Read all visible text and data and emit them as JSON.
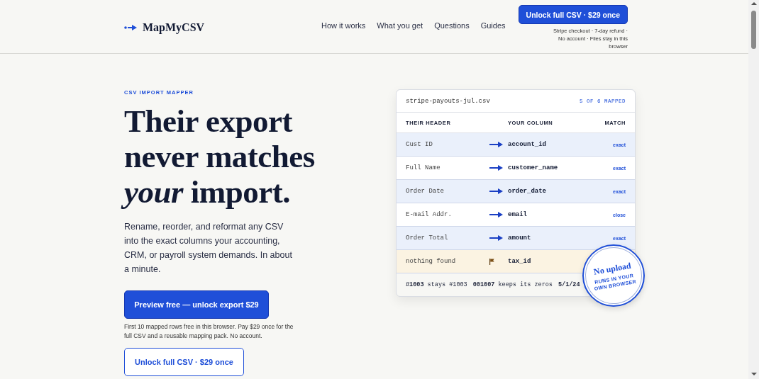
{
  "header": {
    "logo": "MapMyCSV",
    "nav": [
      "How it works",
      "What you get",
      "Questions",
      "Guides"
    ],
    "cta": "Unlock full CSV · $29 once",
    "cta_note": "Stripe checkout · 7-day refund · No account · Files stay in this browser"
  },
  "hero": {
    "eyebrow": "CSV IMPORT MAPPER",
    "heading_lines": [
      "Their export",
      "never matches",
      "*your* import."
    ],
    "lead": "Rename, reorder, and reformat any CSV into the exact columns your accounting, CRM, or payroll system demands. In about a minute.",
    "primary_button": "Preview free — unlock export $29",
    "primary_note": "First 10 mapped rows free in this browser. Pay $29 once for the full CSV and a reusable mapping pack. No account.",
    "secondary_button": "Unlock full CSV · $29 once"
  },
  "mapper": {
    "file_name": "stripe-payouts-jul.csv",
    "status": "5 OF 6 MAPPED",
    "columns": [
      "THEIR HEADER",
      "YOUR COLUMN",
      "MATCH"
    ],
    "rows": [
      {
        "kind": "mapped",
        "their": "Cust ID",
        "yours": "account_id",
        "match": "exact"
      },
      {
        "kind": "mapped",
        "their": "Full Name",
        "yours": "customer_name",
        "match": "exact"
      },
      {
        "kind": "mapped",
        "their": "Order Date",
        "yours": "order_date",
        "match": "exact"
      },
      {
        "kind": "mapped",
        "their": "E-mail Addr.",
        "yours": "email",
        "match": "close"
      },
      {
        "kind": "mapped",
        "their": "Order Total",
        "yours": "amount",
        "match": "exact"
      },
      {
        "kind": "missing",
        "their": "nothing found",
        "yours": "tax_id"
      }
    ],
    "examples": [
      "**#1003** stays #1003",
      "**001007** keeps its zeros",
      "**5/1/24**"
    ],
    "stamp": {
      "title": "No upload",
      "subtitle": "RUNS IN YOUR OWN BROWSER"
    }
  }
}
